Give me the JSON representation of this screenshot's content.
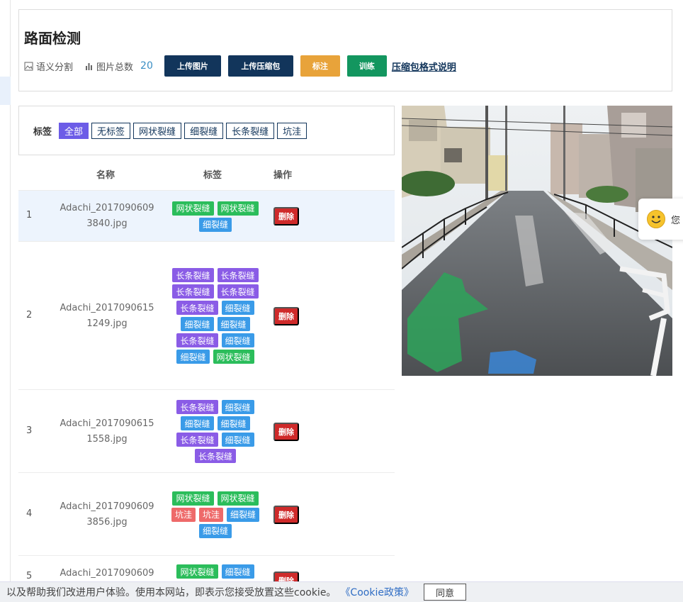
{
  "header": {
    "title": "路面检测",
    "type_label": "语义分割",
    "total_label": "图片总数",
    "total_count": "20",
    "buttons": {
      "upload_image": "上传图片",
      "upload_zip": "上传压缩包",
      "annotate": "标注",
      "train": "训练"
    },
    "zip_help_link": "压缩包格式说明"
  },
  "filter": {
    "label": "标签",
    "chips": [
      "全部",
      "无标签",
      "网状裂缝",
      "细裂缝",
      "长条裂缝",
      "坑洼"
    ],
    "active": "全部"
  },
  "table": {
    "columns": {
      "name": "名称",
      "tags": "标签",
      "ops": "操作"
    },
    "delete_label": "删除",
    "rows": [
      {
        "index": "1",
        "name_line1": "Adachi_2017090609",
        "name_line2": "3840.jpg",
        "tags": [
          "网状裂缝",
          "网状裂缝",
          "细裂缝"
        ]
      },
      {
        "index": "2",
        "name_line1": "Adachi_2017090615",
        "name_line2": "1249.jpg",
        "tags": [
          "长条裂缝",
          "长条裂缝",
          "长条裂缝",
          "长条裂缝",
          "长条裂缝",
          "细裂缝",
          "细裂缝",
          "细裂缝",
          "长条裂缝",
          "细裂缝",
          "细裂缝",
          "网状裂缝"
        ]
      },
      {
        "index": "3",
        "name_line1": "Adachi_2017090615",
        "name_line2": "1558.jpg",
        "tags": [
          "长条裂缝",
          "细裂缝",
          "细裂缝",
          "细裂缝",
          "长条裂缝",
          "细裂缝",
          "长条裂缝"
        ]
      },
      {
        "index": "4",
        "name_line1": "Adachi_2017090609",
        "name_line2": "3856.jpg",
        "tags": [
          "网状裂缝",
          "网状裂缝",
          "坑洼",
          "坑洼",
          "细裂缝",
          "细裂缝"
        ]
      },
      {
        "index": "5",
        "name_line1": "Adachi_2017090609",
        "name_line2": "",
        "tags": [
          "网状裂缝",
          "细裂缝"
        ]
      }
    ]
  },
  "chat": {
    "text": "您"
  },
  "cookie": {
    "text": "，以及帮助我们改进用户体验。使用本网站，即表示您接受放置这些cookie。",
    "link": "《Cookie政策》",
    "agree": "同意"
  },
  "colors": {
    "navy": "#12355b",
    "orange": "#e8a33a",
    "green": "#13965f",
    "tag_mesh": "#2bbd5b",
    "tag_fine": "#3a9be8",
    "tag_long": "#8a5ce6",
    "tag_pothole": "#ee6a6a",
    "delete": "#cf2a2a"
  }
}
